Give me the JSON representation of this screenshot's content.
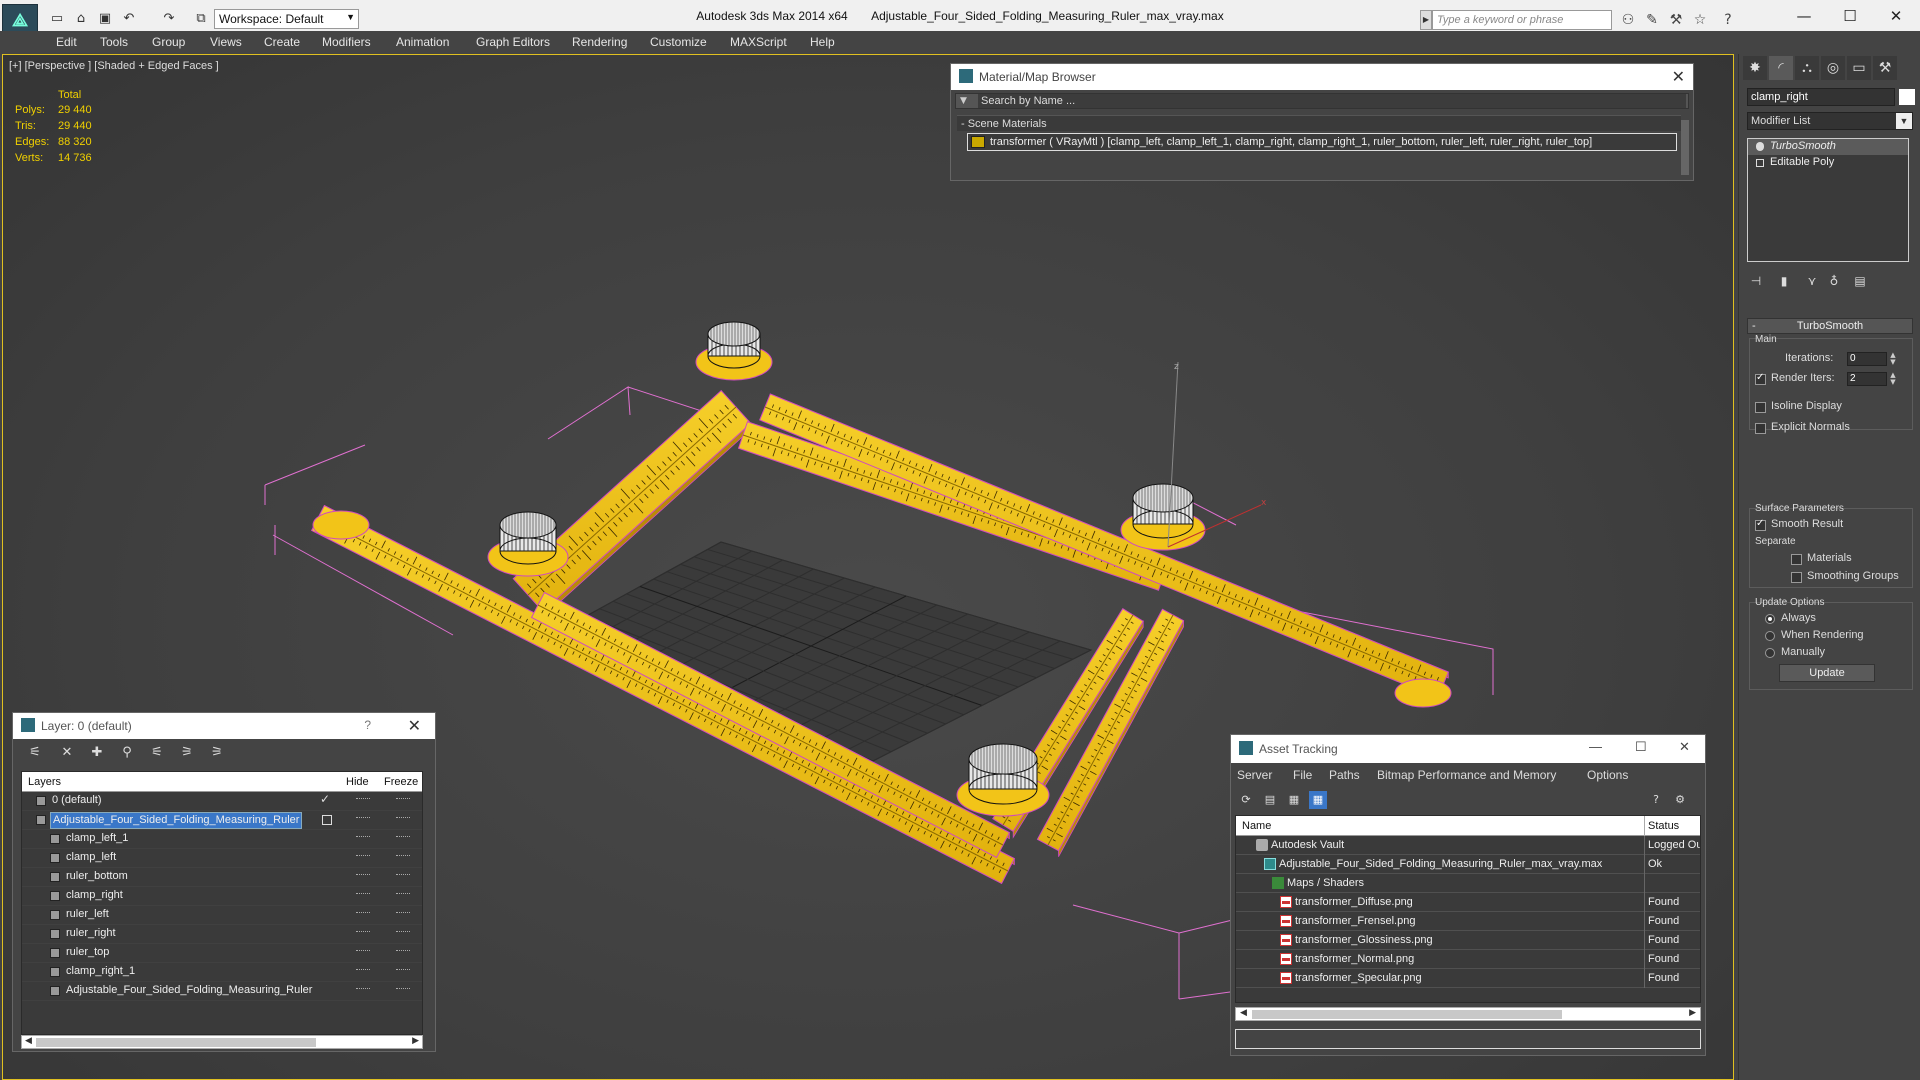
{
  "titlebar": {
    "app_title": "Autodesk 3ds Max  2014 x64",
    "file_title": "Adjustable_Four_Sided_Folding_Measuring_Ruler_max_vray.max",
    "workspace": "Workspace: Default",
    "search_placeholder": "Type a keyword or phrase"
  },
  "menu": [
    "Edit",
    "Tools",
    "Group",
    "Views",
    "Create",
    "Modifiers",
    "Animation",
    "Graph Editors",
    "Rendering",
    "Customize",
    "MAXScript",
    "Help"
  ],
  "viewport": {
    "label": "[+] [Perspective ] [Shaded + Edged Faces ]",
    "stats": {
      "header": "Total",
      "rows": [
        {
          "label": "Polys:",
          "value": "29 440"
        },
        {
          "label": "Tris:",
          "value": "29 440"
        },
        {
          "label": "Edges:",
          "value": "88 320"
        },
        {
          "label": "Verts:",
          "value": "14 736"
        }
      ]
    },
    "axis_labels": {
      "z": "z",
      "x": "x",
      "y": "y"
    },
    "colors": {
      "ruler": "#f2c418",
      "edge": "#d049c0",
      "selection": "#e070d0"
    }
  },
  "material_browser": {
    "title": "Material/Map Browser",
    "search_placeholder": "Search by Name ...",
    "section": "- Scene Materials",
    "entry": "transformer  ( VRayMtl )  [clamp_left, clamp_left_1, clamp_right, clamp_right_1, ruler_bottom, ruler_left, ruler_right, ruler_top]"
  },
  "command_panel": {
    "object_name": "clamp_right",
    "modifier_list": "Modifier List",
    "stack": [
      {
        "label": "TurboSmooth",
        "selected": true
      },
      {
        "label": "Editable Poly",
        "selected": false
      }
    ],
    "turbosmooth": {
      "header": "TurboSmooth",
      "main": "Main",
      "iterations_label": "Iterations:",
      "iterations_value": "0",
      "render_iters_label": "Render Iters:",
      "render_iters_value": "2",
      "isoline": "Isoline Display",
      "explicit_normals": "Explicit Normals",
      "surface_params": "Surface Parameters",
      "smooth_result": "Smooth Result",
      "separate": "Separate",
      "materials": "Materials",
      "smoothing_groups": "Smoothing Groups",
      "update_options": "Update Options",
      "always": "Always",
      "when_rendering": "When Rendering",
      "manually": "Manually",
      "update_button": "Update"
    }
  },
  "layer_panel": {
    "title": "Layer: 0 (default)",
    "help": "?",
    "columns": {
      "layers": "Layers",
      "hide": "Hide",
      "freeze": "Freeze"
    },
    "rows": [
      {
        "name": "0 (default)",
        "indent": 0,
        "kind": "layer",
        "current": true
      },
      {
        "name": "Adjustable_Four_Sided_Folding_Measuring_Ruler",
        "indent": 0,
        "kind": "layer",
        "selected": true
      },
      {
        "name": "clamp_left_1",
        "indent": 1,
        "kind": "object"
      },
      {
        "name": "clamp_left",
        "indent": 1,
        "kind": "object"
      },
      {
        "name": "ruler_bottom",
        "indent": 1,
        "kind": "object"
      },
      {
        "name": "clamp_right",
        "indent": 1,
        "kind": "object"
      },
      {
        "name": "ruler_left",
        "indent": 1,
        "kind": "object"
      },
      {
        "name": "ruler_right",
        "indent": 1,
        "kind": "object"
      },
      {
        "name": "ruler_top",
        "indent": 1,
        "kind": "object"
      },
      {
        "name": "clamp_right_1",
        "indent": 1,
        "kind": "object"
      },
      {
        "name": "Adjustable_Four_Sided_Folding_Measuring_Ruler",
        "indent": 1,
        "kind": "object"
      }
    ]
  },
  "asset_panel": {
    "title": "Asset Tracking",
    "menu": [
      "Server",
      "File",
      "Paths",
      "Bitmap Performance and Memory",
      "Options"
    ],
    "columns": {
      "name": "Name",
      "status": "Status"
    },
    "rows": [
      {
        "name": "Autodesk Vault",
        "status": "Logged Ou",
        "indent": 1,
        "icon": "vault"
      },
      {
        "name": "Adjustable_Four_Sided_Folding_Measuring_Ruler_max_vray.max",
        "status": "Ok",
        "indent": 2,
        "icon": "max"
      },
      {
        "name": "Maps / Shaders",
        "status": "",
        "indent": 3,
        "icon": "maps"
      },
      {
        "name": "transformer_Diffuse.png",
        "status": "Found",
        "indent": 4,
        "icon": "png"
      },
      {
        "name": "transformer_Frensel.png",
        "status": "Found",
        "indent": 4,
        "icon": "png"
      },
      {
        "name": "transformer_Glossiness.png",
        "status": "Found",
        "indent": 4,
        "icon": "png"
      },
      {
        "name": "transformer_Normal.png",
        "status": "Found",
        "indent": 4,
        "icon": "png"
      },
      {
        "name": "transformer_Specular.png",
        "status": "Found",
        "indent": 4,
        "icon": "png"
      }
    ]
  }
}
